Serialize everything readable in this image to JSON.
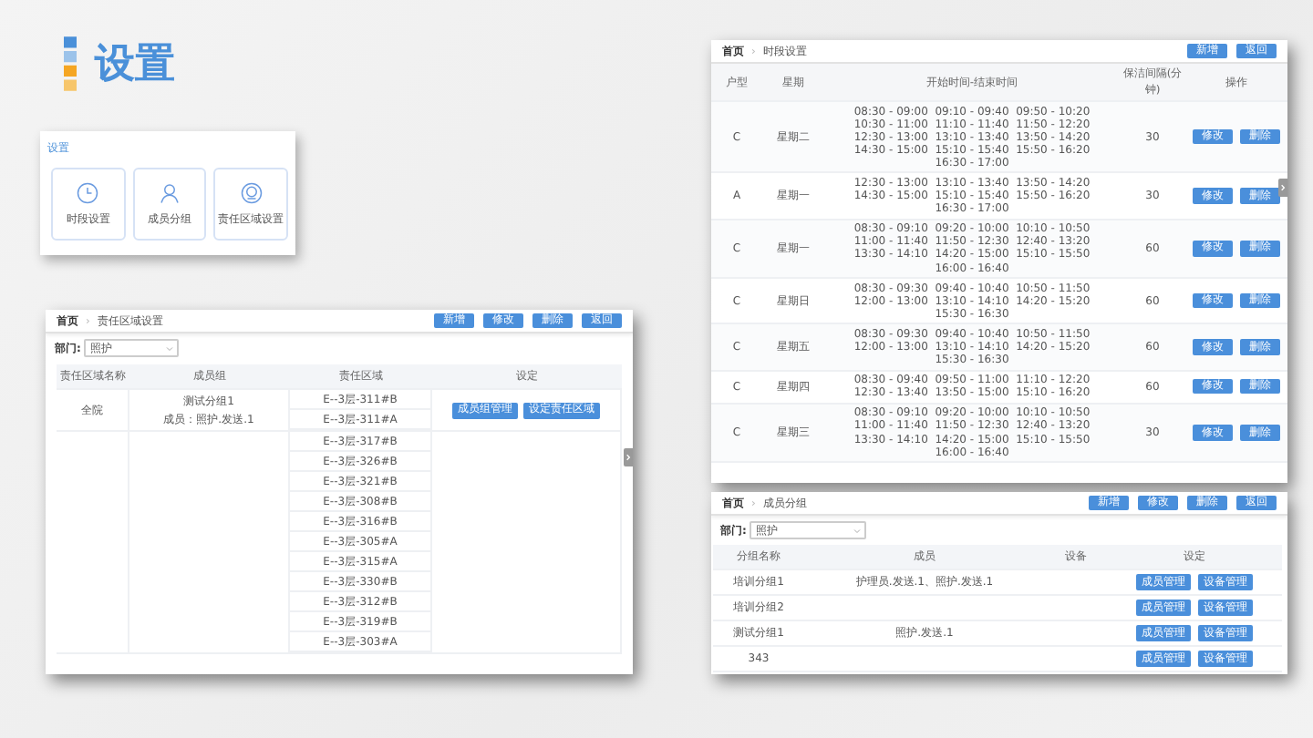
{
  "page_title": "设置",
  "settings_card": {
    "title": "设置",
    "tiles": [
      {
        "label": "时段设置"
      },
      {
        "label": "成员分组"
      },
      {
        "label": "责任区域设置"
      }
    ]
  },
  "area_panel": {
    "breadcrumb": [
      "首页",
      "责任区域设置"
    ],
    "breadcrumb_separator": "›",
    "buttons": [
      "新增",
      "修改",
      "删除",
      "返回"
    ],
    "department_label": "部门:",
    "department_value": "照护",
    "columns": [
      "责任区域名称",
      "成员组",
      "责任区域",
      "设定"
    ],
    "rows": [
      {
        "name": "全院",
        "group": "测试分组1",
        "members": "成员：照护.发送.1",
        "areas": [
          "E--3层-311#B",
          "E--3层-311#A"
        ],
        "actions": [
          "成员组管理",
          "设定责任区域"
        ]
      },
      {
        "areas": [
          "E--3层-317#B",
          "E--3层-326#B",
          "E--3层-321#B",
          "E--3层-308#B",
          "E--3层-316#B",
          "E--3层-305#A",
          "E--3层-315#A",
          "E--3层-330#B",
          "E--3层-312#B",
          "E--3层-319#B",
          "E--3层-303#A"
        ],
        "actions": []
      }
    ]
  },
  "timeslot_panel": {
    "breadcrumb": [
      "首页",
      "时段设置"
    ],
    "breadcrumb_separator": "›",
    "buttons": [
      "新增",
      "返回"
    ],
    "columns": [
      "户型",
      "星期",
      "开始时间-结束时间",
      "保洁间隔(分钟)",
      "操作"
    ],
    "rows": [
      {
        "type": "C",
        "weekday": "星期二",
        "slots": [
          "08:30 - 09:00  09:10 - 09:40  09:50 - 10:20",
          "10:30 - 11:00  11:10 - 11:40  11:50 - 12:20",
          "12:30 - 13:00  13:10 - 13:40  13:50 - 14:20",
          "14:30 - 15:00  15:10 - 15:40  15:50 - 16:20",
          "16:30 - 17:00"
        ],
        "interval": "30",
        "actions": [
          "修改",
          "删除"
        ]
      },
      {
        "type": "A",
        "weekday": "星期一",
        "slots": [
          "12:30 - 13:00  13:10 - 13:40  13:50 - 14:20",
          "14:30 - 15:00  15:10 - 15:40  15:50 - 16:20",
          "16:30 - 17:00"
        ],
        "interval": "30",
        "actions": [
          "修改",
          "删除"
        ]
      },
      {
        "type": "C",
        "weekday": "星期一",
        "slots": [
          "08:30 - 09:10  09:20 - 10:00  10:10 - 10:50",
          "11:00 - 11:40  11:50 - 12:30  12:40 - 13:20",
          "13:30 - 14:10  14:20 - 15:00  15:10 - 15:50",
          "16:00 - 16:40"
        ],
        "interval": "60",
        "actions": [
          "修改",
          "删除"
        ]
      },
      {
        "type": "C",
        "weekday": "星期日",
        "slots": [
          "08:30 - 09:30  09:40 - 10:40  10:50 - 11:50",
          "12:00 - 13:00  13:10 - 14:10  14:20 - 15:20",
          "15:30 - 16:30"
        ],
        "interval": "60",
        "actions": [
          "修改",
          "删除"
        ]
      },
      {
        "type": "C",
        "weekday": "星期五",
        "slots": [
          "08:30 - 09:30  09:40 - 10:40  10:50 - 11:50",
          "12:00 - 13:00  13:10 - 14:10  14:20 - 15:20",
          "15:30 - 16:30"
        ],
        "interval": "60",
        "actions": [
          "修改",
          "删除"
        ]
      },
      {
        "type": "C",
        "weekday": "星期四",
        "slots": [
          "08:30 - 09:40  09:50 - 11:00  11:10 - 12:20",
          "12:30 - 13:40  13:50 - 15:00  15:10 - 16:20"
        ],
        "interval": "60",
        "actions": [
          "修改",
          "删除"
        ]
      },
      {
        "type": "C",
        "weekday": "星期三",
        "slots": [
          "08:30 - 09:10  09:20 - 10:00  10:10 - 10:50",
          "11:00 - 11:40  11:50 - 12:30  12:40 - 13:20",
          "13:30 - 14:10  14:20 - 15:00  15:10 - 15:50",
          "16:00 - 16:40"
        ],
        "interval": "30",
        "actions": [
          "修改",
          "删除"
        ]
      }
    ]
  },
  "group_panel": {
    "breadcrumb": [
      "首页",
      "成员分组"
    ],
    "breadcrumb_separator": "›",
    "buttons": [
      "新增",
      "修改",
      "删除",
      "返回"
    ],
    "department_label": "部门:",
    "department_value": "照护",
    "columns": [
      "分组名称",
      "成员",
      "设备",
      "设定"
    ],
    "rows": [
      {
        "name": "培训分组1",
        "members": "护理员.发送.1、照护.发送.1",
        "actions": [
          "成员管理",
          "设备管理"
        ]
      },
      {
        "name": "培训分组2",
        "actions": [
          "成员管理",
          "设备管理"
        ]
      },
      {
        "name": "测试分组1",
        "members": "照护.发送.1",
        "actions": [
          "成员管理",
          "设备管理"
        ]
      },
      {
        "name": "343",
        "actions": [
          "成员管理",
          "设备管理"
        ]
      }
    ]
  }
}
